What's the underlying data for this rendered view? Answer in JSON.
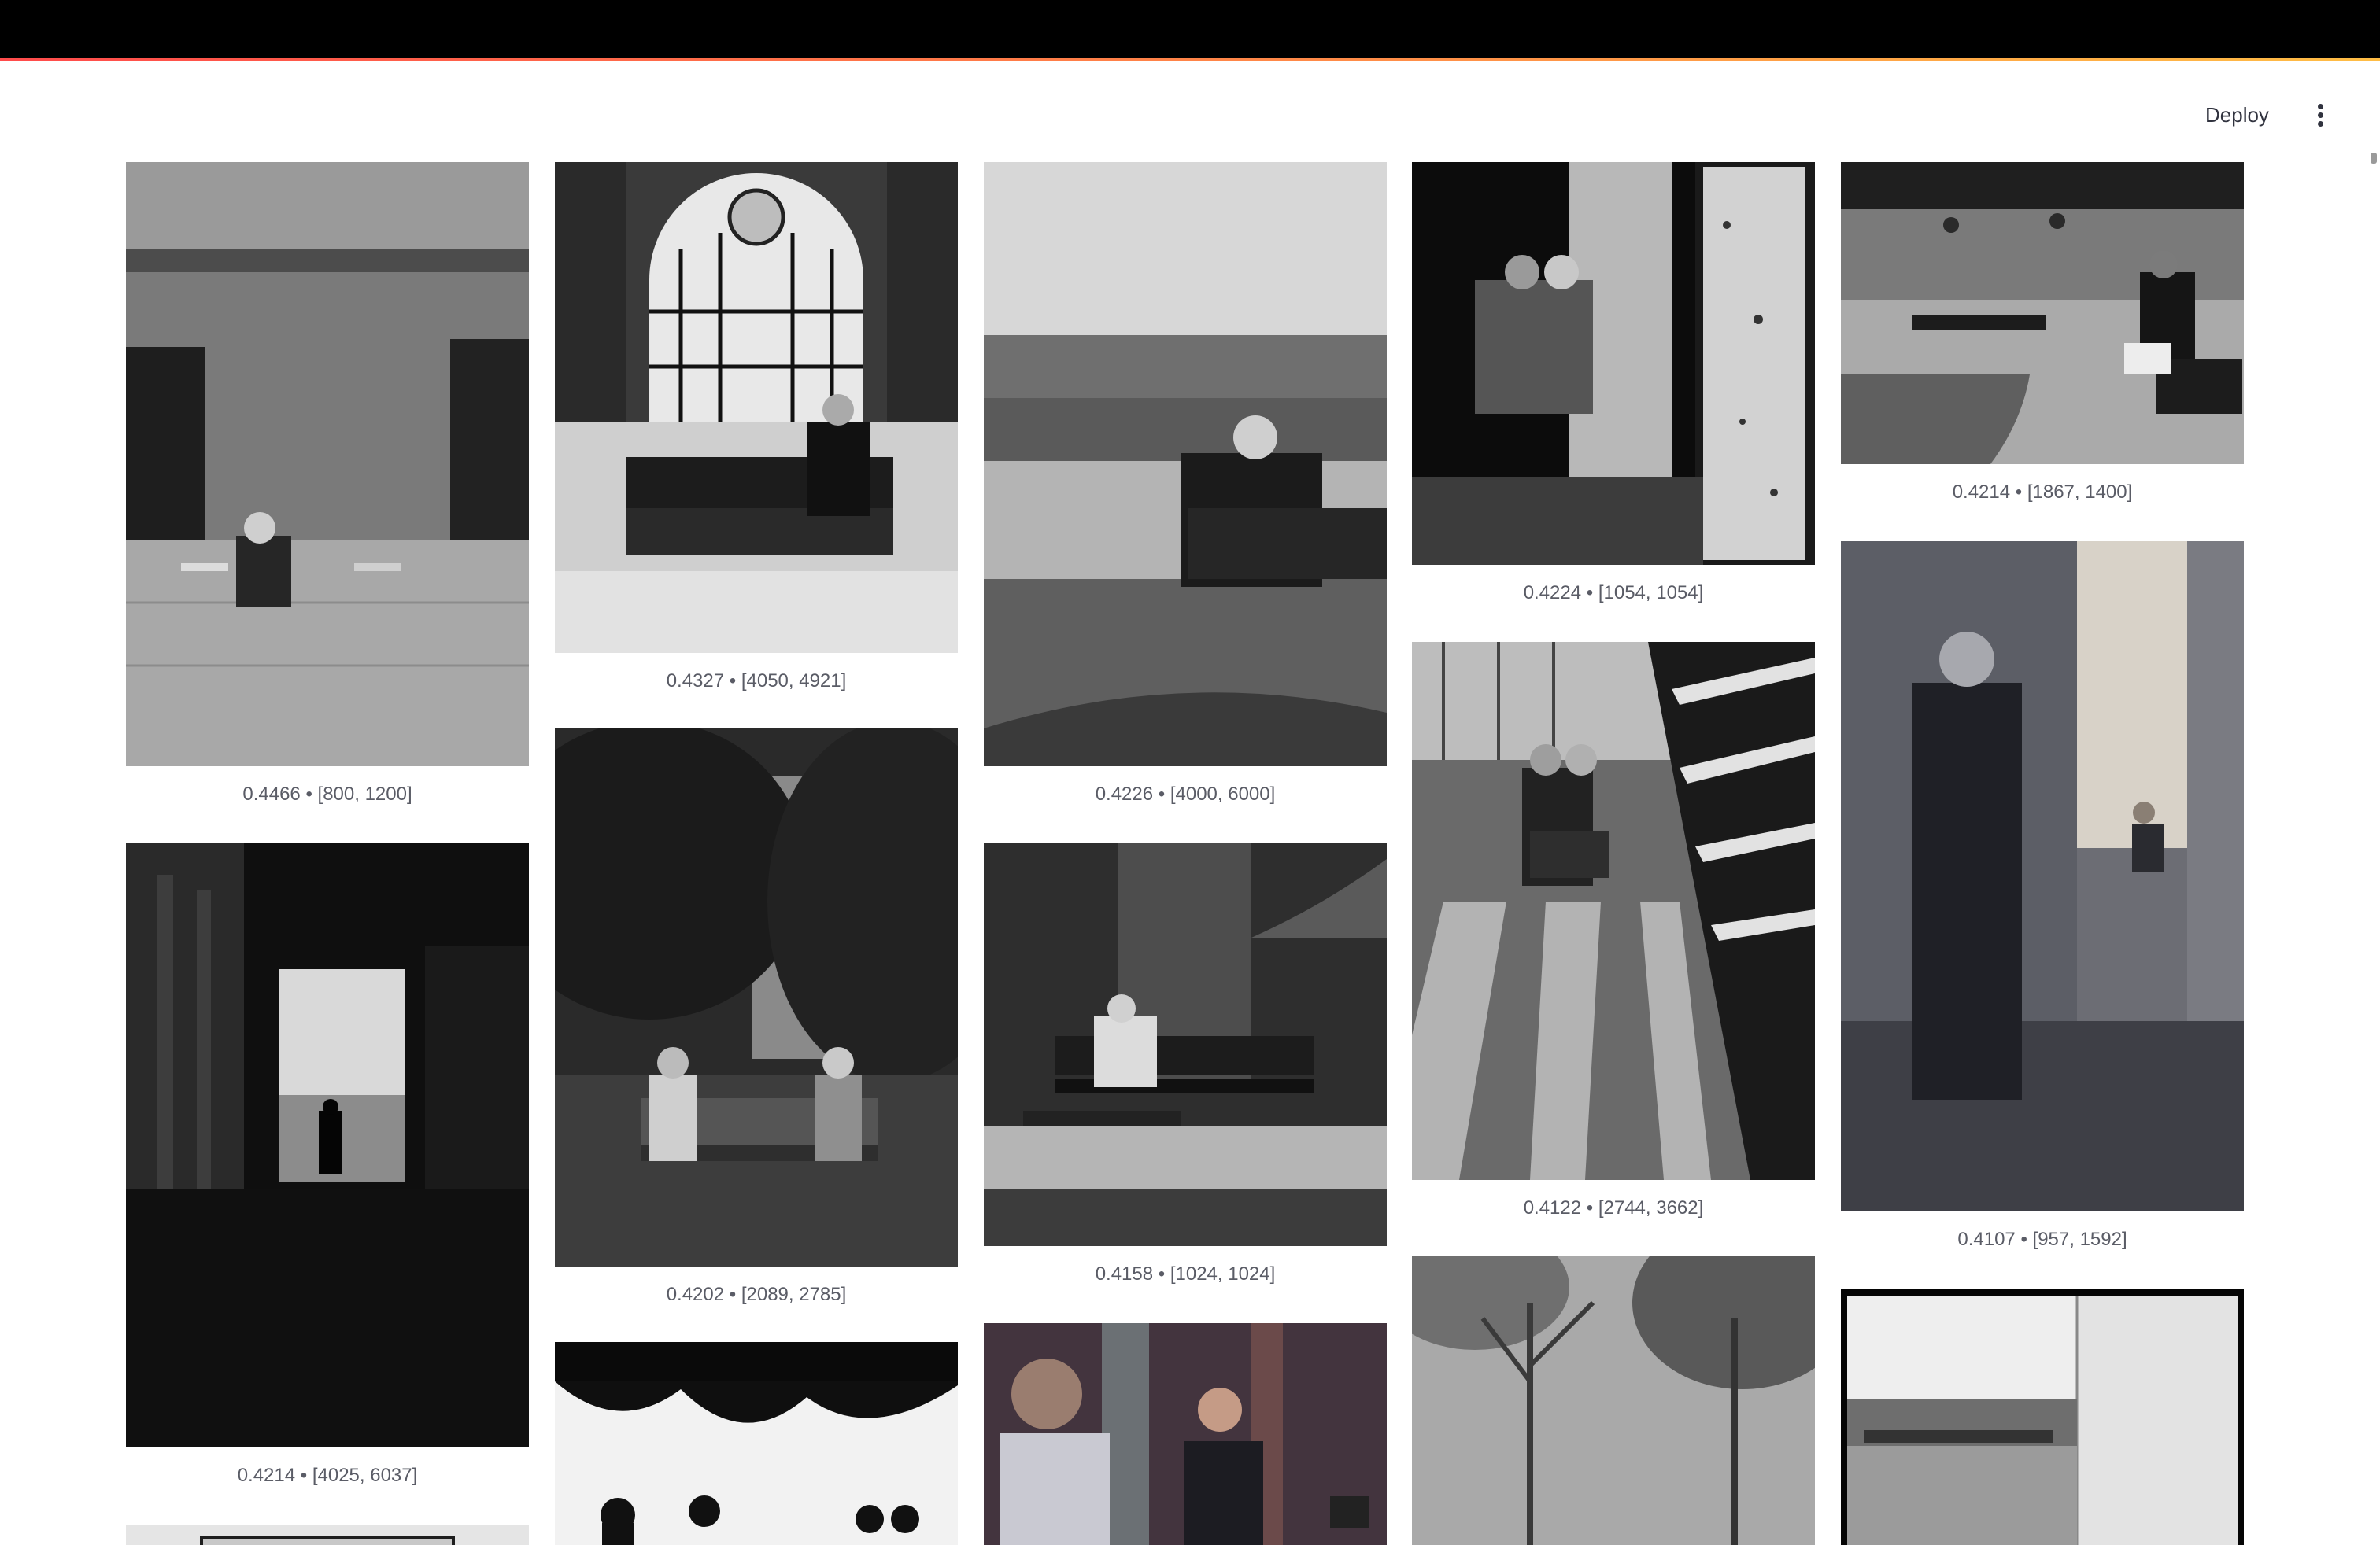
{
  "header": {
    "deploy_label": "Deploy",
    "menu_icon": "more-vertical-icon"
  },
  "gallery": {
    "items": [
      {
        "caption": "0.4466 • [800, 1200]",
        "tone": "#6f6f6f"
      },
      {
        "caption": "0.4214 • [4025, 6037]",
        "tone": "#1a1a1a"
      },
      {
        "caption": "",
        "tone": "#d8d8d8"
      },
      {
        "caption": "0.4327 • [4050, 4921]",
        "tone": "#4a4a4a"
      },
      {
        "caption": "0.4202 • [2089, 2785]",
        "tone": "#2f2f2f"
      },
      {
        "caption": "",
        "tone": "#3a3a3a"
      },
      {
        "caption": "0.4226 • [4000, 6000]",
        "tone": "#8a8a8a"
      },
      {
        "caption": "0.4158 • [1024, 1024]",
        "tone": "#555555"
      },
      {
        "caption": "",
        "tone": "#5b3a3a"
      },
      {
        "caption": "0.4224 • [1054, 1054]",
        "tone": "#2b2b2b"
      },
      {
        "caption": "0.4122 • [2744, 3662]",
        "tone": "#5e5e5e"
      },
      {
        "caption": "",
        "tone": "#7d7d7d"
      },
      {
        "caption": "0.4214 • [1867, 1400]",
        "tone": "#7a7a7a"
      },
      {
        "caption": "0.4107 • [957, 1592]",
        "tone": "#4d4e55"
      },
      {
        "caption": "",
        "tone": "#a9a9a9"
      }
    ]
  }
}
